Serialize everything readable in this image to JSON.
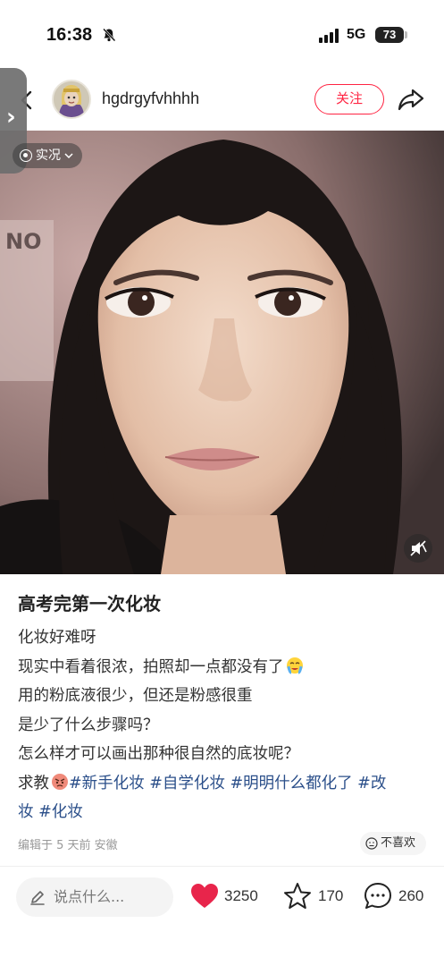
{
  "status_bar": {
    "time": "16:38",
    "network": "5G",
    "battery": "73",
    "icons": [
      "bell-slash-icon",
      "signal-icon",
      "battery-icon"
    ]
  },
  "header": {
    "username": "hgdrgyfvhhhh",
    "follow_label": "关注",
    "icons": [
      "back-icon",
      "share-icon",
      "side-tab-arrow-icon"
    ]
  },
  "photo": {
    "live_label": "实况",
    "icons": [
      "live-photo-icon",
      "chevron-down-icon",
      "mute-icon"
    ]
  },
  "post": {
    "title": "高考完第一次化妆",
    "lines": [
      "化妆好难呀",
      "现实中看着很浓，拍照却一点都没有了",
      "用的粉底液很少，但还是粉感很重",
      "是少了什么步骤吗？",
      "怎么样才可以画出那种很自然的底妆呢？"
    ],
    "ask_prefix": "求教",
    "tags_line1": "#新手化妆 #自学化妆 #明明什么都化了 #改",
    "tags_line2": "妆 #化妆",
    "meta": "编辑于 5 天前 安徽",
    "dislike_label": "不喜欢"
  },
  "bottom_bar": {
    "comment_placeholder": "说点什么...",
    "like_count": "3250",
    "star_count": "170",
    "comment_count": "260"
  },
  "colors": {
    "accent": "#ff2442",
    "tag": "#2b4f8a",
    "like": "#e8254b"
  }
}
